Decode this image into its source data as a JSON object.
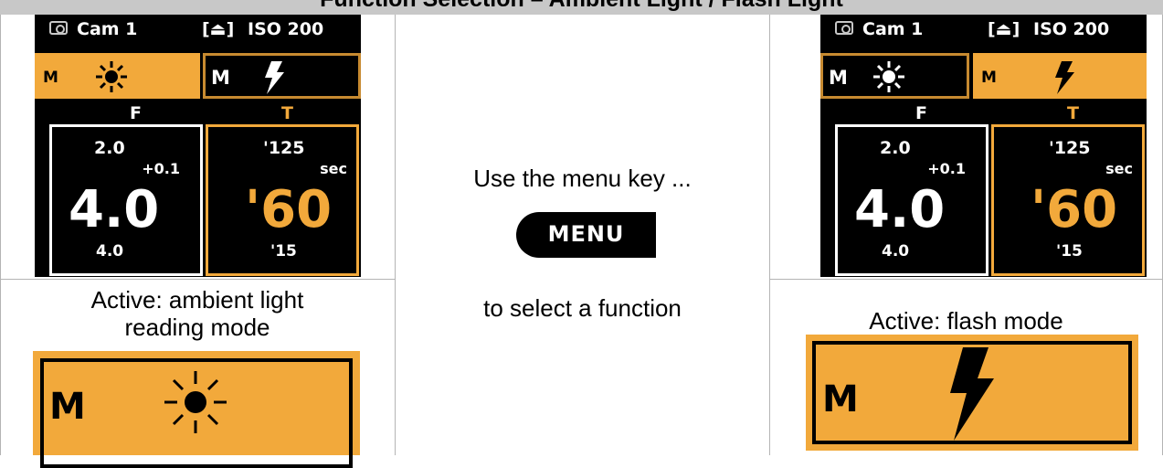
{
  "title": "Function Selection – Ambient Light / Flash Light",
  "screens": {
    "camera_label": "Cam 1",
    "meter_icon": "[⏏]",
    "iso_label": "ISO 200",
    "mode_letter": "M",
    "ambient_icon": "sun-icon",
    "flash_icon": "lightning-bolt-icon",
    "f_label": "F",
    "t_label": "T",
    "f_top": "2.0",
    "f_offset": "+0.1",
    "f_main": "4.0",
    "f_bottom": "4.0",
    "t_top": "'125",
    "t_unit": "sec",
    "t_main": "'60",
    "t_bottom": "'15"
  },
  "center": {
    "instruction_top": "Use the menu key ...",
    "menu_key_label": "MENU",
    "instruction_bottom": "to select a function"
  },
  "left_caption": "Active: ambient light reading mode",
  "right_caption": "Active: flash mode",
  "colors": {
    "accent": "#f2a93b",
    "screen_bg": "#000000",
    "title_bar": "#c8c8c8"
  }
}
